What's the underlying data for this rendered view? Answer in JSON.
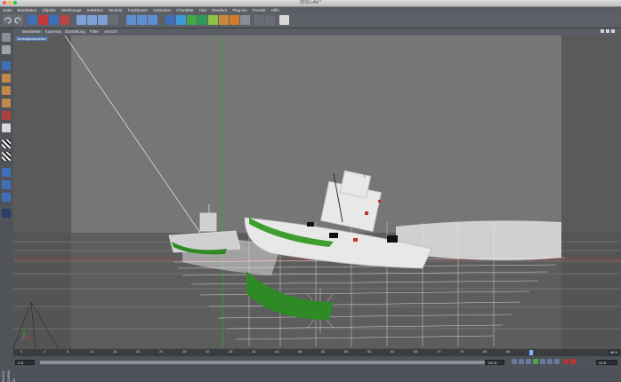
{
  "window": {
    "title": "2010.c4d *"
  },
  "menu": [
    "Datei",
    "Bearbeiten",
    "Objekte",
    "Werkzeuge",
    "Selektion",
    "Struktur",
    "Funktionen",
    "Animation",
    "Charakter",
    "Hair",
    "Rendern",
    "Plug-ins",
    "Fenster",
    "Hilfe"
  ],
  "viewport_menu": [
    "Bearbeiten",
    "Kameras",
    "Darstellung",
    "Filter",
    "Ansicht"
  ],
  "viewport_label": "Zentralperspektive",
  "timeline": {
    "ticks": [
      "0",
      "4",
      "8",
      "12",
      "16",
      "20",
      "24",
      "28",
      "32",
      "36",
      "40",
      "44",
      "48",
      "52",
      "56",
      "60",
      "64",
      "68",
      "72",
      "76",
      "80",
      "84",
      "88"
    ],
    "current_frame_label": "88 B"
  },
  "bottom": {
    "start": "0 B",
    "end": "100 B",
    "fps": "43 B"
  },
  "side_label": "MAXON CINEMA 4D",
  "colors": {
    "accent": "#7bb3ff",
    "boat_green": "#2e8a24"
  }
}
